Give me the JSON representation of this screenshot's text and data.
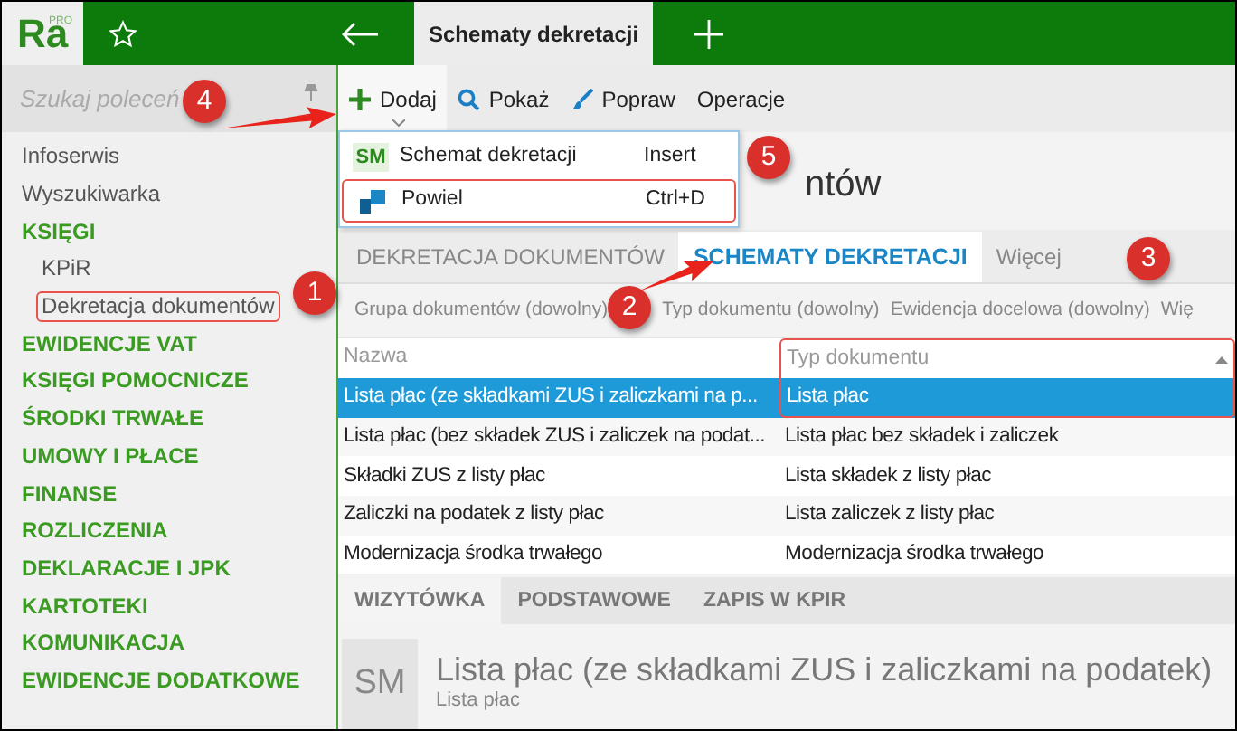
{
  "logo": {
    "text": "Ra",
    "tag": "PRO"
  },
  "active_tab": {
    "title": "Schematy dekretacji"
  },
  "sidebar": {
    "search": {
      "placeholder": "Szukaj poleceń"
    },
    "items": [
      {
        "label": "Infoserwis",
        "kind": "link",
        "annotated": false
      },
      {
        "label": "Wyszukiwarka",
        "kind": "link",
        "annotated": false
      },
      {
        "label": "KSIĘGI",
        "kind": "section",
        "annotated": false,
        "children": [
          {
            "label": "KPiR",
            "kind": "link",
            "annotated": false
          },
          {
            "label": "Dekretacja dokumentów",
            "kind": "link",
            "annotated": true
          }
        ]
      },
      {
        "label": "EWIDENCJE VAT",
        "kind": "section",
        "annotated": false
      },
      {
        "label": "KSIĘGI POMOCNICZE",
        "kind": "section",
        "annotated": false
      },
      {
        "label": "ŚRODKI TRWAŁE",
        "kind": "section",
        "annotated": false
      },
      {
        "label": "UMOWY I PŁACE",
        "kind": "section",
        "annotated": false
      },
      {
        "label": "FINANSE",
        "kind": "section",
        "annotated": false
      },
      {
        "label": "ROZLICZENIA",
        "kind": "section",
        "annotated": false
      },
      {
        "label": "DEKLARACJE I JPK",
        "kind": "section",
        "annotated": false
      },
      {
        "label": "KARTOTEKI",
        "kind": "section",
        "annotated": false
      },
      {
        "label": "KOMUNIKACJA",
        "kind": "section",
        "annotated": false
      },
      {
        "label": "EWIDENCJE DODATKOWE",
        "kind": "section",
        "annotated": false
      }
    ]
  },
  "toolbar": [
    {
      "label": "Dodaj",
      "open": true
    },
    {
      "label": "Pokaż",
      "open": false
    },
    {
      "label": "Popraw",
      "open": false
    },
    {
      "label": "Operacje",
      "open": false
    }
  ],
  "menu": [
    {
      "kind": "badge",
      "badge": "SM",
      "label": "Schemat dekretacji",
      "shortcut": "Insert",
      "annotated": false
    },
    {
      "kind": "icon",
      "label": "Powiel",
      "shortcut": "Ctrl+D",
      "annotated": true
    }
  ],
  "heading": "ntów",
  "tabs": [
    {
      "label": "DEKRETACJA DOKUMENTÓW",
      "selected": false
    },
    {
      "label": "SCHEMATY DEKRETACJI",
      "selected": true
    },
    {
      "label": "Więcej",
      "selected": false
    }
  ],
  "filters": [
    "Grupa dokumentów (dowolny)",
    "Typ dokumentu (dowolny)",
    "Ewidencja docelowa (dowolny)",
    "Wię"
  ],
  "table": {
    "columns": [
      {
        "label": "Nazwa",
        "annotated": false
      },
      {
        "label": "Typ dokumentu",
        "annotated": true
      }
    ],
    "rows": [
      {
        "cells": [
          "Lista płac (ze składkami ZUS i zaliczkami na p...",
          "Lista płac"
        ],
        "selected": true
      },
      {
        "cells": [
          "Lista płac (bez składek ZUS i zaliczek na podat...",
          "Lista płac bez składek i zaliczek"
        ],
        "selected": false
      },
      {
        "cells": [
          "Składki ZUS z listy płac",
          "Lista składek z listy płac"
        ],
        "selected": false
      },
      {
        "cells": [
          "Zaliczki na podatek z listy płac",
          "Lista zaliczek z listy płac"
        ],
        "selected": false
      },
      {
        "cells": [
          "Modernizacja środka trwałego",
          "Modernizacja środka trwałego"
        ],
        "selected": false
      }
    ]
  },
  "detail_tabs": [
    {
      "label": "WIZYTÓWKA",
      "selected": true
    },
    {
      "label": "PODSTAWOWE",
      "selected": false
    },
    {
      "label": "ZAPIS W KPIR",
      "selected": false
    }
  ],
  "card": {
    "badge": "SM",
    "title": "Lista płac (ze składkami ZUS i zaliczkami na podatek)",
    "subtitle": "Lista płac"
  },
  "callouts": [
    "1",
    "2",
    "3",
    "4",
    "5"
  ]
}
